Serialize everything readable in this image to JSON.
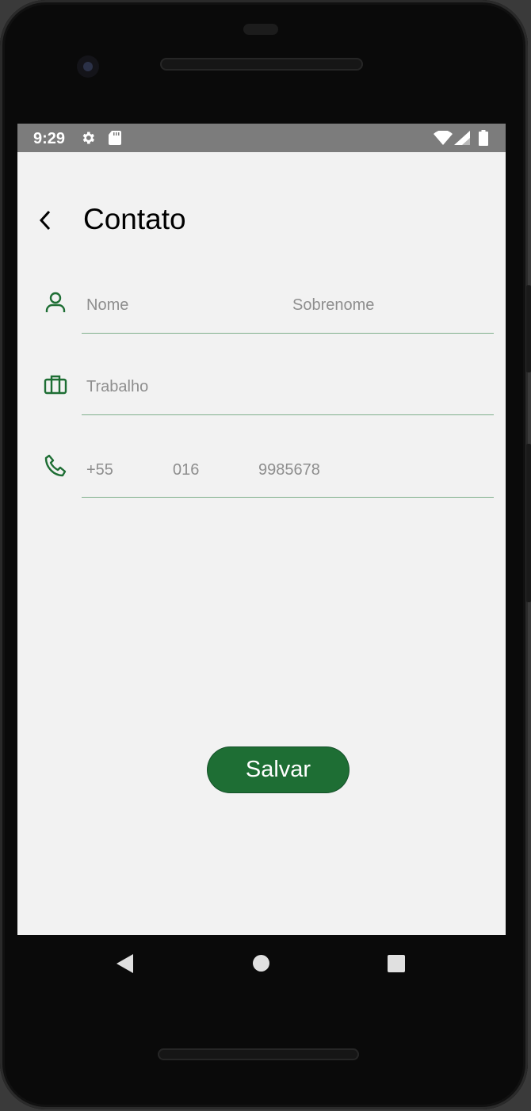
{
  "status_bar": {
    "time": "9:29",
    "icons": [
      "gear-icon",
      "sd-card-icon",
      "wifi-icon",
      "signal-icon",
      "battery-icon"
    ]
  },
  "app_bar": {
    "title": "Contato",
    "back_icon": "chevron-left-icon"
  },
  "form": {
    "name": {
      "icon": "person-icon",
      "first_placeholder": "Nome",
      "last_placeholder": "Sobrenome"
    },
    "work": {
      "icon": "briefcase-icon",
      "placeholder": "Trabalho"
    },
    "phone": {
      "icon": "phone-icon",
      "country_code": "+55",
      "area_code": "016",
      "number": "9985678"
    }
  },
  "save_button": {
    "label": "Salvar"
  },
  "colors": {
    "accent": "#1e6e34",
    "icon": "#1e6e34",
    "underline": "#7fb08c",
    "status_bar": "#7c7c7c",
    "background": "#f2f2f2"
  },
  "nav_bar": {
    "buttons": [
      "back-triangle-icon",
      "home-circle-icon",
      "recents-square-icon"
    ]
  }
}
